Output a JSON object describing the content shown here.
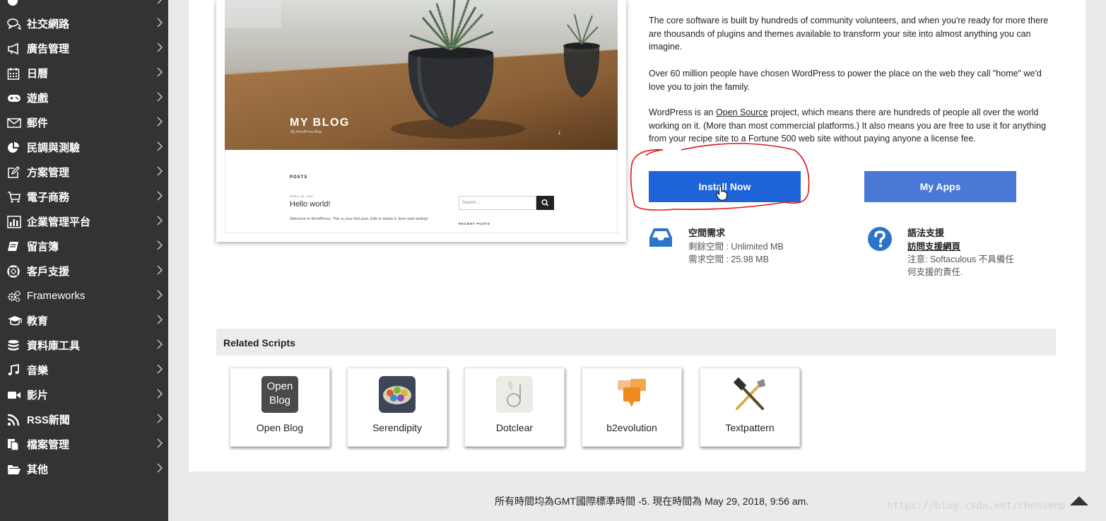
{
  "sidebar": {
    "items": [
      {
        "label": "社交網路",
        "icon": "chat-bubbles-icon"
      },
      {
        "label": "廣告管理",
        "icon": "megaphone-icon"
      },
      {
        "label": "日曆",
        "icon": "calendar-icon"
      },
      {
        "label": "遊戲",
        "icon": "gamepad-icon"
      },
      {
        "label": "郵件",
        "icon": "envelope-icon"
      },
      {
        "label": "民調與測驗",
        "icon": "pie-chart-icon"
      },
      {
        "label": "方案管理",
        "icon": "edit-square-icon"
      },
      {
        "label": "電子商務",
        "icon": "shopping-cart-icon"
      },
      {
        "label": "企業管理平台",
        "icon": "bar-chart-icon"
      },
      {
        "label": "留言簿",
        "icon": "book-icon"
      },
      {
        "label": "客戶支援",
        "icon": "lifebuoy-icon"
      },
      {
        "label": "Frameworks",
        "icon": "cogs-icon"
      },
      {
        "label": "教育",
        "icon": "graduation-cap-icon"
      },
      {
        "label": "資料庫工具",
        "icon": "database-icon"
      },
      {
        "label": "音樂",
        "icon": "music-note-icon"
      },
      {
        "label": "影片",
        "icon": "video-camera-icon"
      },
      {
        "label": "RSS新聞",
        "icon": "rss-icon"
      },
      {
        "label": "檔案管理",
        "icon": "files-icon"
      },
      {
        "label": "其他",
        "icon": "folder-open-icon"
      }
    ]
  },
  "preview": {
    "blog_title": "MY BLOG",
    "blog_subtitle": "My WordPress Blog",
    "posts_heading": "POSTS",
    "post_date": "APRIL 18, 2017",
    "post_title": "Hello world!",
    "post_excerpt": "Welcome to WordPress. This is your first post. Edit or delete it, then start writing!",
    "search_placeholder": "Search ...",
    "recent_posts_heading": "RECENT POSTS"
  },
  "description": {
    "p1": "The core software is built by hundreds of community volunteers, and when you're ready for more there are thousands of plugins and themes available to transform your site into almost anything you can imagine.",
    "p2": "Over 60 million people have chosen WordPress to power the place on the web they call \"home\" we'd love you to join the family.",
    "p3_before": "WordPress is an ",
    "p3_link": "Open Source",
    "p3_after": " project, which means there are hundreds of people all over the world working on it. (More than most commercial platforms.) It also means you are free to use it for anything from your recipe site to a Fortune 500 web site without paying anyone a license fee."
  },
  "actions": {
    "install_label": "Install Now",
    "myapps_label": "My Apps"
  },
  "space": {
    "title": "空間需求",
    "remaining": "剩餘空間 : Unlimited MB",
    "required": "需求空間 : 25.98 MB"
  },
  "support": {
    "title": "語法支援",
    "link": "訪問支援網頁",
    "note_line1": "注意: Softaculous 不具備任",
    "note_line2": "何支援的責任."
  },
  "related": {
    "title": "Related Scripts",
    "scripts": [
      {
        "name": "Open Blog",
        "icon": "open-blog-icon",
        "icon_text_1": "Open",
        "icon_text_2": "Blog"
      },
      {
        "name": "Serendipity",
        "icon": "serendipity-icon"
      },
      {
        "name": "Dotclear",
        "icon": "dotclear-icon"
      },
      {
        "name": "b2evolution",
        "icon": "b2evolution-icon"
      },
      {
        "name": "Textpattern",
        "icon": "textpattern-icon"
      }
    ]
  },
  "footer": {
    "time_text": "所有時間均為GMT國際標準時間 -5. 現在時間為 May 29, 2018, 9:56 am.",
    "watermark": "https://blog.csdn.net/chensenp"
  },
  "colors": {
    "sidebar_bg": "#333333",
    "install_button": "#1e63d8",
    "myapps_button": "#4a78d6",
    "annotation_red": "#e0141a"
  }
}
